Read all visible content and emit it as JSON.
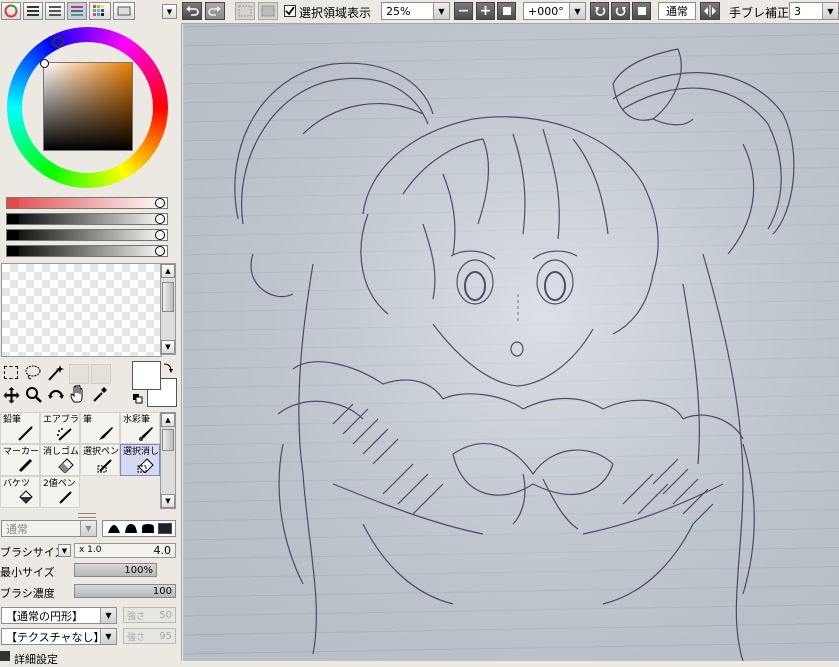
{
  "toolbar": {
    "selection_checkbox_label": "選択領域表示",
    "selection_checked": true,
    "zoom": "25%",
    "rotation": "+000°",
    "view_mode": "通常",
    "stabilizer_label": "手ブレ補正",
    "stabilizer_value": "3"
  },
  "color_panel": {
    "primary_color": "#ffffff",
    "secondary_color": "#ffffff",
    "hsv_square_hue": "#e87d00"
  },
  "tools": [
    {
      "label": "鉛筆",
      "icon": "pencil-icon",
      "selected": false
    },
    {
      "label": "エアブラシ",
      "icon": "airbrush-icon",
      "selected": false
    },
    {
      "label": "筆",
      "icon": "brush-icon",
      "selected": false
    },
    {
      "label": "水彩筆",
      "icon": "watercolor-icon",
      "selected": false
    },
    {
      "label": "マーカー",
      "icon": "marker-icon",
      "selected": false
    },
    {
      "label": "消しゴム",
      "icon": "eraser-icon",
      "selected": false
    },
    {
      "label": "選択ペン",
      "icon": "selection-pen-icon",
      "selected": false
    },
    {
      "label": "選択消し",
      "icon": "selection-eraser-icon",
      "selected": true
    },
    {
      "label": "バケツ",
      "icon": "bucket-icon",
      "selected": false
    },
    {
      "label": "2値ペン",
      "icon": "binary-pen-icon",
      "selected": false
    }
  ],
  "brush_settings": {
    "blend_mode": "通常",
    "brush_size_label": "ブラシサイズ",
    "size_multiplier": "x 1.0",
    "brush_size_value": "4.0",
    "min_size_label": "最小サイズ",
    "min_size_value": "100%",
    "density_label": "ブラシ濃度",
    "density_value": "100",
    "shape": "【通常の円形】",
    "shape_strength_label": "強さ",
    "shape_strength_value": "50",
    "texture": "【テクスチャなし】",
    "texture_strength_label": "強さ",
    "texture_strength_value": "95",
    "advanced_label": "詳細設定"
  }
}
